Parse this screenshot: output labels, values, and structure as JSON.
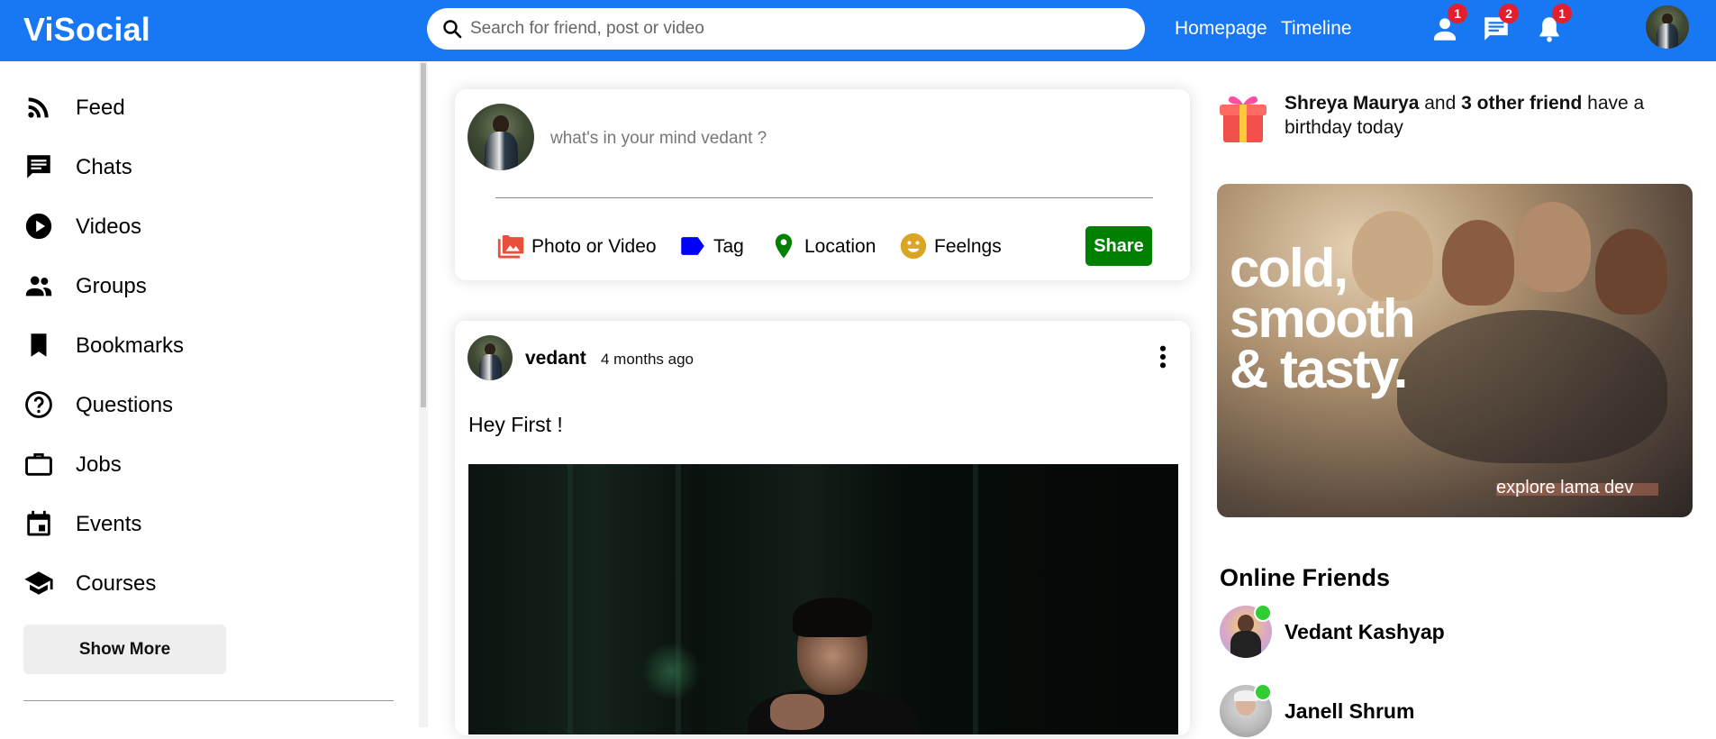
{
  "app": {
    "logo": "ViSocial",
    "accent": "#1877f2"
  },
  "topbar": {
    "search_placeholder": "Search for friend, post or video",
    "links": [
      "Homepage",
      "Timeline"
    ],
    "icons": [
      {
        "name": "person-icon",
        "badge": "1"
      },
      {
        "name": "chat-icon",
        "badge": "2"
      },
      {
        "name": "notification-icon",
        "badge": "1"
      }
    ]
  },
  "sidebar": {
    "items": [
      {
        "label": "Feed",
        "icon": "rss-feed-icon"
      },
      {
        "label": "Chats",
        "icon": "chat-icon"
      },
      {
        "label": "Videos",
        "icon": "play-circle-icon"
      },
      {
        "label": "Groups",
        "icon": "group-icon"
      },
      {
        "label": "Bookmarks",
        "icon": "bookmark-icon"
      },
      {
        "label": "Questions",
        "icon": "help-outline-icon"
      },
      {
        "label": "Jobs",
        "icon": "work-outline-icon"
      },
      {
        "label": "Events",
        "icon": "event-icon"
      },
      {
        "label": "Courses",
        "icon": "school-icon"
      }
    ],
    "show_more": "Show More"
  },
  "share": {
    "placeholder": "what's in your mind vedant ?",
    "options": [
      {
        "label": "Photo or Video",
        "icon": "perm-media-icon",
        "color": "#e8503c"
      },
      {
        "label": "Tag",
        "icon": "label-icon",
        "color": "#0000ff"
      },
      {
        "label": "Location",
        "icon": "room-icon",
        "color": "#008000"
      },
      {
        "label": "Feelngs",
        "icon": "emoji-emotions-icon",
        "color": "#daa520"
      }
    ],
    "button": "Share",
    "button_color": "#008000"
  },
  "post": {
    "username": "vedant",
    "date": "4 months ago",
    "text": "Hey First !"
  },
  "rightbar": {
    "birthday": {
      "name": "Shreya Maurya",
      "connector": " and ",
      "others": "3 other friend",
      "suffix": " have a birthday today"
    },
    "ad": {
      "line1": "cold,",
      "line2": "smooth",
      "line3": "& tasty.",
      "footer": "explore lama dev"
    },
    "online_title": "Online Friends",
    "friends": [
      "Vedant Kashyap",
      "Janell Shrum"
    ],
    "online_color": "#32cd32"
  }
}
